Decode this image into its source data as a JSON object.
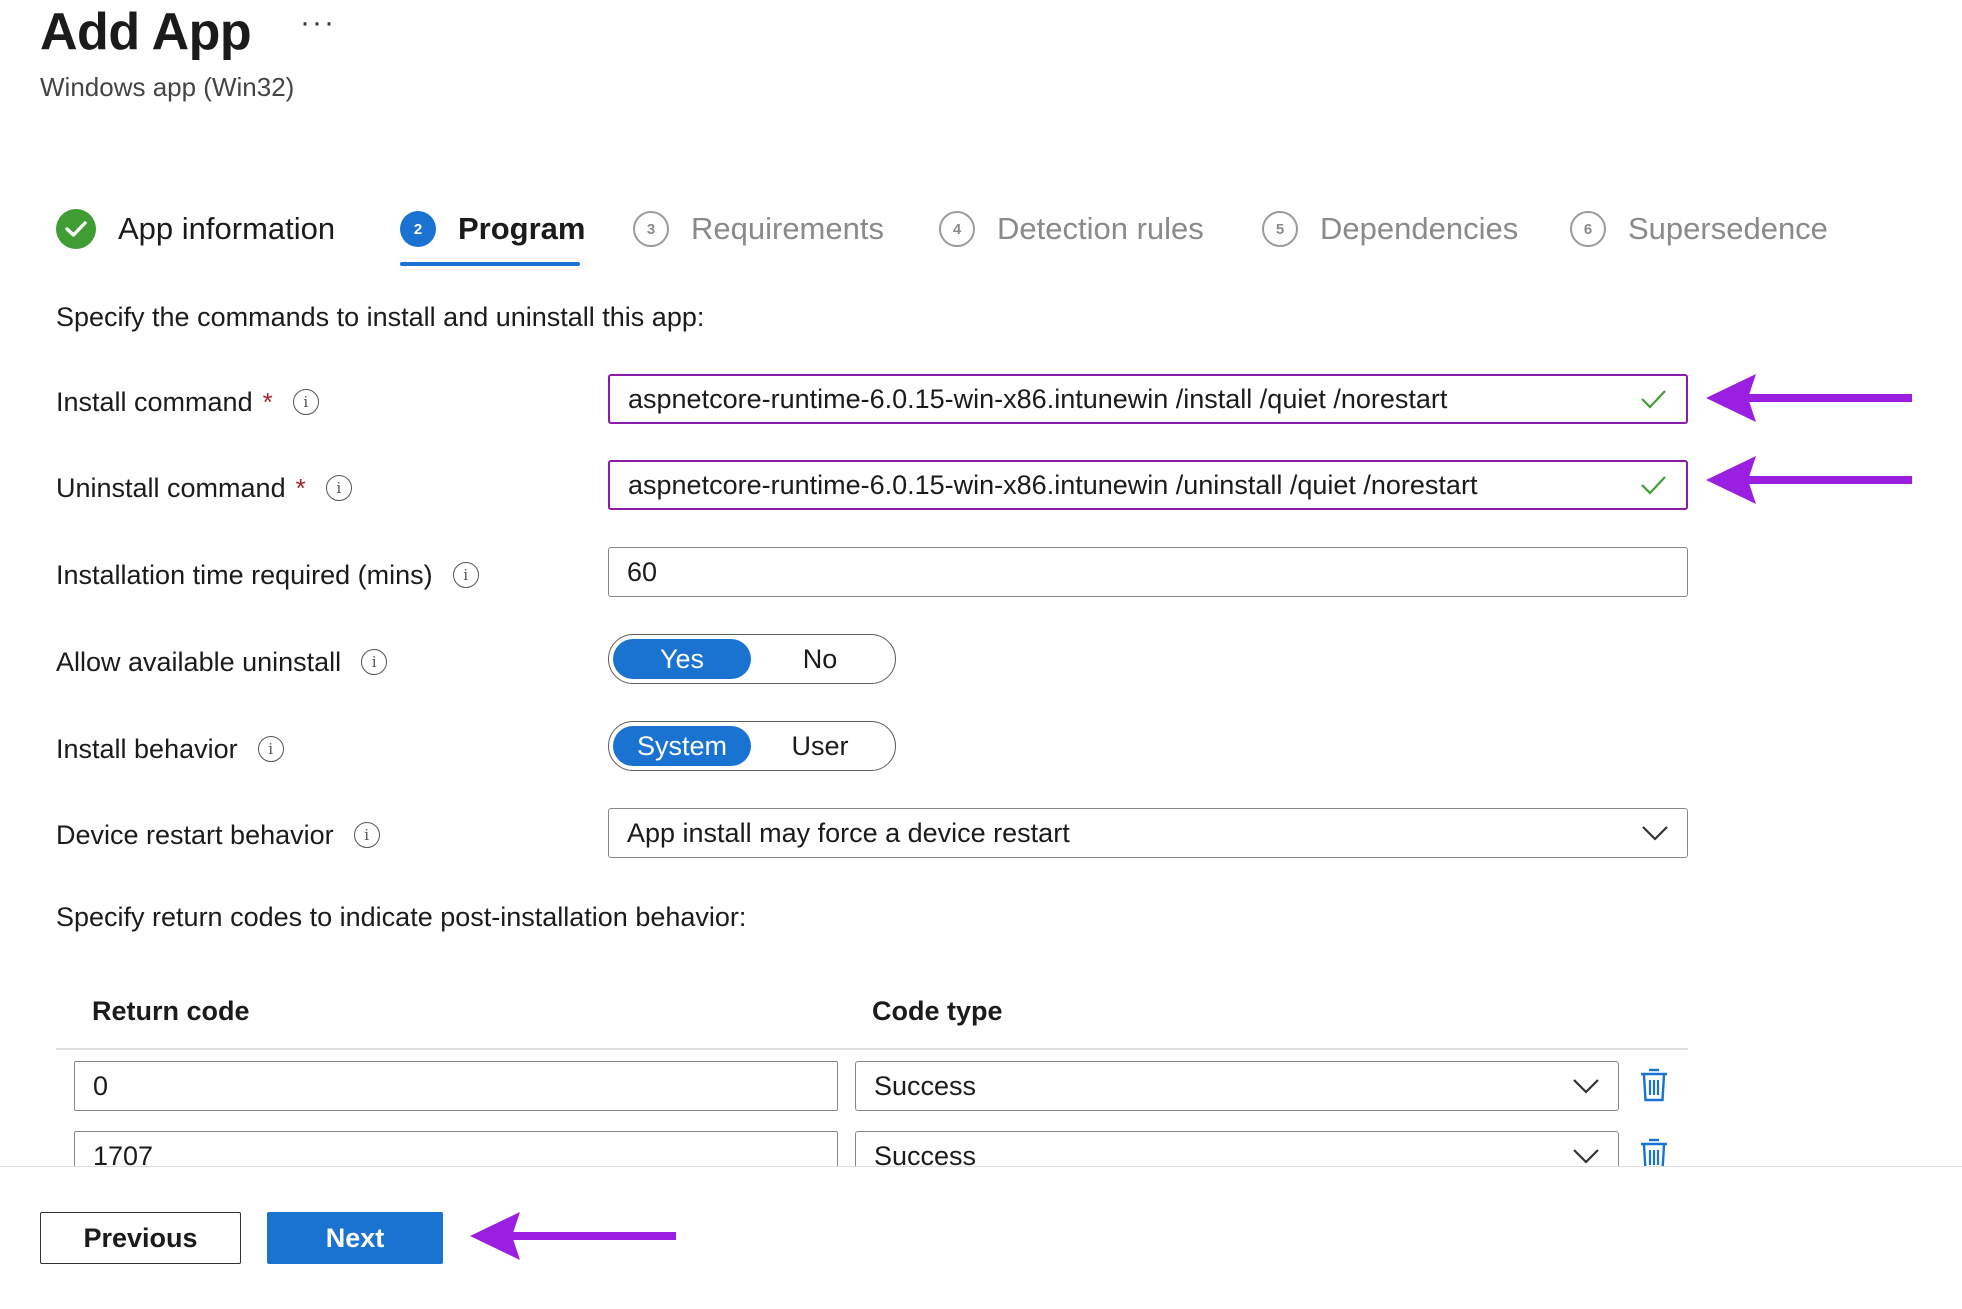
{
  "header": {
    "title": "Add App",
    "more_label": "···",
    "subtitle": "Windows app (Win32)"
  },
  "steps": [
    {
      "label": "App information",
      "state": "done",
      "number": ""
    },
    {
      "label": "Program",
      "state": "active",
      "number": "2"
    },
    {
      "label": "Requirements",
      "state": "todo",
      "number": "3"
    },
    {
      "label": "Detection rules",
      "state": "todo",
      "number": "4"
    },
    {
      "label": "Dependencies",
      "state": "todo",
      "number": "5"
    },
    {
      "label": "Supersedence",
      "state": "todo",
      "number": "6"
    }
  ],
  "program": {
    "intro": "Specify the commands to install and uninstall this app:",
    "install_command": {
      "label": "Install command",
      "required": "*",
      "value": "aspnetcore-runtime-6.0.15-win-x86.intunewin /install /quiet /norestart"
    },
    "uninstall_command": {
      "label": "Uninstall command",
      "required": "*",
      "value": "aspnetcore-runtime-6.0.15-win-x86.intunewin /uninstall /quiet /norestart"
    },
    "install_time": {
      "label": "Installation time required (mins)",
      "value": "60"
    },
    "allow_uninstall": {
      "label": "Allow available uninstall",
      "options": [
        "Yes",
        "No"
      ],
      "selected": "Yes"
    },
    "install_behavior": {
      "label": "Install behavior",
      "options": [
        "System",
        "User"
      ],
      "selected": "System"
    },
    "restart_behavior": {
      "label": "Device restart behavior",
      "value": "App install may force a device restart"
    },
    "info_glyph": "i"
  },
  "return_codes": {
    "intro": "Specify return codes to indicate post-installation behavior:",
    "columns": [
      "Return code",
      "Code type"
    ],
    "rows": [
      {
        "code": "0",
        "type": "Success"
      },
      {
        "code": "1707",
        "type": "Success"
      }
    ]
  },
  "footer": {
    "previous_label": "Previous",
    "next_label": "Next"
  },
  "colors": {
    "accent": "#1a73d0",
    "success": "#3f9d34",
    "annotation_arrow": "#9b1fe0",
    "highlight_border": "#8b1aa8"
  },
  "icons": {
    "check": "checkmark-icon",
    "info": "info-icon",
    "chevron": "chevron-down-icon",
    "trash": "trash-icon",
    "arrow": "arrow-left-icon"
  }
}
